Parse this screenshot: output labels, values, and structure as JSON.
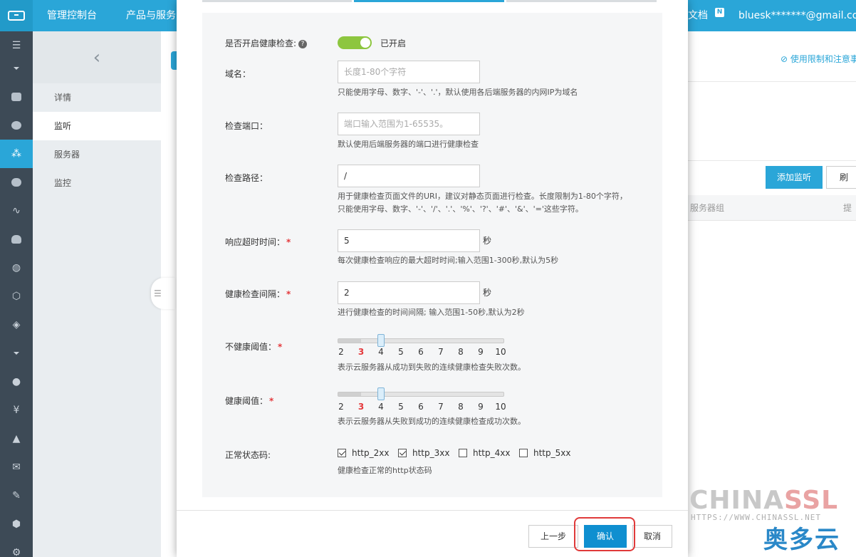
{
  "topbar": {
    "nav": [
      "管理控制台",
      "产品与服务"
    ],
    "doc": "文档",
    "badge": "N",
    "user": "bluesk*******@gmail.com"
  },
  "subside": {
    "back": "‹",
    "items": [
      "详情",
      "监听",
      "服务器",
      "监控"
    ]
  },
  "background": {
    "limit_link": "使用限制和注意事",
    "add_listener": "添加监听",
    "refresh": "刷新",
    "col_server_group": "服务器组",
    "col_provide": "提"
  },
  "form": {
    "health_check": {
      "label": "是否开启健康检查:",
      "help": "?",
      "status": "已开启"
    },
    "domain": {
      "label": "域名：",
      "placeholder": "长度1-80个字符",
      "hint": "只能使用字母、数字、'-'、'.'，默认使用各后端服务器的内网IP为域名"
    },
    "port": {
      "label": "检查端口：",
      "placeholder": "端口输入范围为1-65535。",
      "hint": "默认使用后端服务器的端口进行健康检查"
    },
    "path": {
      "label": "检查路径：",
      "value": "/",
      "hint1": "用于健康检查页面文件的URI，建议对静态页面进行检查。长度限制为1-80个字符，",
      "hint2": "只能使用字母、数字、'-'、'/'、'.'、'%'、'?'、'#'、'&'、'='这些字符。"
    },
    "timeout": {
      "label": "响应超时时间：",
      "req": "*",
      "value": "5",
      "unit": "秒",
      "hint": "每次健康检查响应的最大超时时间;输入范围1-300秒,默认为5秒"
    },
    "interval": {
      "label": "健康检查间隔：",
      "req": "*",
      "value": "2",
      "unit": "秒",
      "hint": "进行健康检查的时间间隔; 输入范围1-50秒,默认为2秒"
    },
    "unhealthy": {
      "label": "不健康阈值：",
      "req": "*",
      "ticks": [
        "2",
        "3",
        "4",
        "5",
        "6",
        "7",
        "8",
        "9",
        "10"
      ],
      "value": 3,
      "min": 2,
      "max": 10,
      "hint": "表示云服务器从成功到失败的连续健康检查失败次数。"
    },
    "healthy": {
      "label": "健康阈值：",
      "req": "*",
      "ticks": [
        "2",
        "3",
        "4",
        "5",
        "6",
        "7",
        "8",
        "9",
        "10"
      ],
      "value": 3,
      "min": 2,
      "max": 10,
      "hint": "表示云服务器从失败到成功的连续健康检查成功次数。"
    },
    "status_codes": {
      "label": "正常状态码:",
      "options": [
        {
          "label": "http_2xx",
          "checked": true
        },
        {
          "label": "http_3xx",
          "checked": true
        },
        {
          "label": "http_4xx",
          "checked": false
        },
        {
          "label": "http_5xx",
          "checked": false
        }
      ],
      "hint": "健康检查正常的http状态码"
    }
  },
  "footer": {
    "prev": "上一步",
    "confirm": "确认",
    "cancel": "取消"
  },
  "watermark": {
    "brand_a": "CHINA",
    "brand_b": "SSL",
    "url": "HTTPS://WWW.CHINASSL.NET",
    "cn": "奥多云"
  },
  "colors": {
    "accent": "#2aa6d8",
    "primary_button": "#0f8fd0",
    "switch_on": "#8dc63f",
    "required": "#e4393c",
    "highlight": "#e03a3a"
  }
}
